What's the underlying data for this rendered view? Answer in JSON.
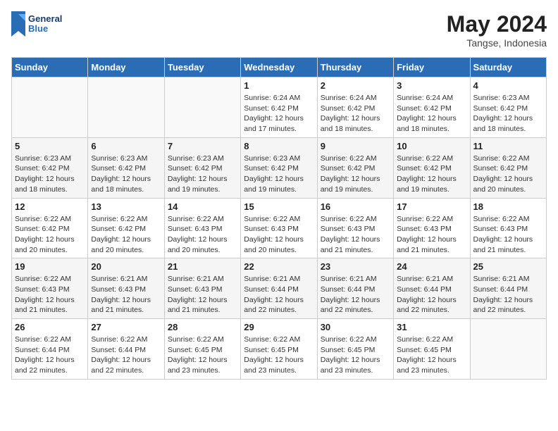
{
  "header": {
    "logo_line1": "General",
    "logo_line2": "Blue",
    "month_title": "May 2024",
    "location": "Tangse, Indonesia"
  },
  "days_of_week": [
    "Sunday",
    "Monday",
    "Tuesday",
    "Wednesday",
    "Thursday",
    "Friday",
    "Saturday"
  ],
  "weeks": [
    [
      {
        "day": "",
        "sunrise": "",
        "sunset": "",
        "daylight": ""
      },
      {
        "day": "",
        "sunrise": "",
        "sunset": "",
        "daylight": ""
      },
      {
        "day": "",
        "sunrise": "",
        "sunset": "",
        "daylight": ""
      },
      {
        "day": "1",
        "sunrise": "6:24 AM",
        "sunset": "6:42 PM",
        "daylight": "12 hours and 17 minutes."
      },
      {
        "day": "2",
        "sunrise": "6:24 AM",
        "sunset": "6:42 PM",
        "daylight": "12 hours and 18 minutes."
      },
      {
        "day": "3",
        "sunrise": "6:24 AM",
        "sunset": "6:42 PM",
        "daylight": "12 hours and 18 minutes."
      },
      {
        "day": "4",
        "sunrise": "6:23 AM",
        "sunset": "6:42 PM",
        "daylight": "12 hours and 18 minutes."
      }
    ],
    [
      {
        "day": "5",
        "sunrise": "6:23 AM",
        "sunset": "6:42 PM",
        "daylight": "12 hours and 18 minutes."
      },
      {
        "day": "6",
        "sunrise": "6:23 AM",
        "sunset": "6:42 PM",
        "daylight": "12 hours and 18 minutes."
      },
      {
        "day": "7",
        "sunrise": "6:23 AM",
        "sunset": "6:42 PM",
        "daylight": "12 hours and 19 minutes."
      },
      {
        "day": "8",
        "sunrise": "6:23 AM",
        "sunset": "6:42 PM",
        "daylight": "12 hours and 19 minutes."
      },
      {
        "day": "9",
        "sunrise": "6:22 AM",
        "sunset": "6:42 PM",
        "daylight": "12 hours and 19 minutes."
      },
      {
        "day": "10",
        "sunrise": "6:22 AM",
        "sunset": "6:42 PM",
        "daylight": "12 hours and 19 minutes."
      },
      {
        "day": "11",
        "sunrise": "6:22 AM",
        "sunset": "6:42 PM",
        "daylight": "12 hours and 20 minutes."
      }
    ],
    [
      {
        "day": "12",
        "sunrise": "6:22 AM",
        "sunset": "6:42 PM",
        "daylight": "12 hours and 20 minutes."
      },
      {
        "day": "13",
        "sunrise": "6:22 AM",
        "sunset": "6:42 PM",
        "daylight": "12 hours and 20 minutes."
      },
      {
        "day": "14",
        "sunrise": "6:22 AM",
        "sunset": "6:43 PM",
        "daylight": "12 hours and 20 minutes."
      },
      {
        "day": "15",
        "sunrise": "6:22 AM",
        "sunset": "6:43 PM",
        "daylight": "12 hours and 20 minutes."
      },
      {
        "day": "16",
        "sunrise": "6:22 AM",
        "sunset": "6:43 PM",
        "daylight": "12 hours and 21 minutes."
      },
      {
        "day": "17",
        "sunrise": "6:22 AM",
        "sunset": "6:43 PM",
        "daylight": "12 hours and 21 minutes."
      },
      {
        "day": "18",
        "sunrise": "6:22 AM",
        "sunset": "6:43 PM",
        "daylight": "12 hours and 21 minutes."
      }
    ],
    [
      {
        "day": "19",
        "sunrise": "6:22 AM",
        "sunset": "6:43 PM",
        "daylight": "12 hours and 21 minutes."
      },
      {
        "day": "20",
        "sunrise": "6:21 AM",
        "sunset": "6:43 PM",
        "daylight": "12 hours and 21 minutes."
      },
      {
        "day": "21",
        "sunrise": "6:21 AM",
        "sunset": "6:43 PM",
        "daylight": "12 hours and 21 minutes."
      },
      {
        "day": "22",
        "sunrise": "6:21 AM",
        "sunset": "6:44 PM",
        "daylight": "12 hours and 22 minutes."
      },
      {
        "day": "23",
        "sunrise": "6:21 AM",
        "sunset": "6:44 PM",
        "daylight": "12 hours and 22 minutes."
      },
      {
        "day": "24",
        "sunrise": "6:21 AM",
        "sunset": "6:44 PM",
        "daylight": "12 hours and 22 minutes."
      },
      {
        "day": "25",
        "sunrise": "6:21 AM",
        "sunset": "6:44 PM",
        "daylight": "12 hours and 22 minutes."
      }
    ],
    [
      {
        "day": "26",
        "sunrise": "6:22 AM",
        "sunset": "6:44 PM",
        "daylight": "12 hours and 22 minutes."
      },
      {
        "day": "27",
        "sunrise": "6:22 AM",
        "sunset": "6:44 PM",
        "daylight": "12 hours and 22 minutes."
      },
      {
        "day": "28",
        "sunrise": "6:22 AM",
        "sunset": "6:45 PM",
        "daylight": "12 hours and 23 minutes."
      },
      {
        "day": "29",
        "sunrise": "6:22 AM",
        "sunset": "6:45 PM",
        "daylight": "12 hours and 23 minutes."
      },
      {
        "day": "30",
        "sunrise": "6:22 AM",
        "sunset": "6:45 PM",
        "daylight": "12 hours and 23 minutes."
      },
      {
        "day": "31",
        "sunrise": "6:22 AM",
        "sunset": "6:45 PM",
        "daylight": "12 hours and 23 minutes."
      },
      {
        "day": "",
        "sunrise": "",
        "sunset": "",
        "daylight": ""
      }
    ]
  ],
  "labels": {
    "sunrise_prefix": "Sunrise: ",
    "sunset_prefix": "Sunset: ",
    "daylight_prefix": "Daylight: "
  }
}
